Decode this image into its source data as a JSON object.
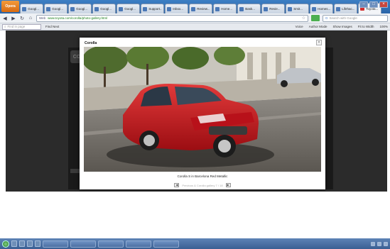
{
  "browser": {
    "app_label": "Opera",
    "tabs": [
      {
        "label": "Googl...",
        "active": false
      },
      {
        "label": "Googl...",
        "active": false
      },
      {
        "label": "Googl...",
        "active": false
      },
      {
        "label": "Googl...",
        "active": false
      },
      {
        "label": "Googl...",
        "active": false
      },
      {
        "label": "Support...",
        "active": false
      },
      {
        "label": "Inbox...",
        "active": false
      },
      {
        "label": "Review...",
        "active": false
      },
      {
        "label": "Home...",
        "active": false
      },
      {
        "label": "Bask...",
        "active": false
      },
      {
        "label": "Revie...",
        "active": false
      },
      {
        "label": "Smit...",
        "active": false
      },
      {
        "label": "Homes...",
        "active": false
      },
      {
        "label": "Lifehac...",
        "active": false
      },
      {
        "label": "Toyota...",
        "active": true
      }
    ],
    "identity": "Web",
    "url": "www.toyota.com/corolla/photo-gallery.html",
    "search_placeholder": "Search with Google",
    "find_placeholder": "Find in page",
    "find_next": "Find Next",
    "tools": [
      "Voice",
      "Author Mode",
      "Show Images",
      "Fit to Width",
      "100%"
    ]
  },
  "background_site": {
    "logo": "CO"
  },
  "gallery": {
    "title": "Corolla",
    "caption": "Corolla S in Barcelona Red Metallic",
    "pager_text": "Previous & Corolla gallery 7 / 18"
  },
  "colors": {
    "car_red": "#c8141a",
    "browser_blue": "#2a64a8",
    "overlay": "#2b2b2b"
  }
}
